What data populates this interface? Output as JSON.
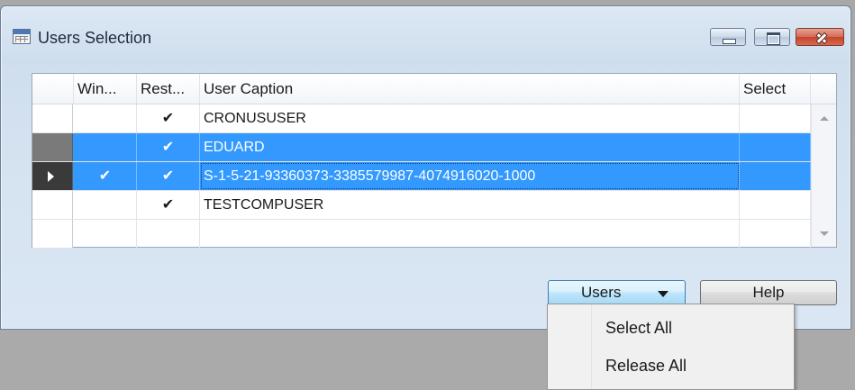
{
  "window": {
    "title": "Users Selection",
    "title_icon": "table-form-icon",
    "controls": {
      "minimize": "minimize-icon",
      "maximize": "maximize-icon",
      "close": "close-icon"
    }
  },
  "grid": {
    "columns": [
      "Win...",
      "Rest...",
      "User Caption",
      "Select"
    ],
    "rows": [
      {
        "win": "",
        "rest": "✔",
        "caption": "CRONUSUSER",
        "select": ""
      },
      {
        "win": "",
        "rest": "✔",
        "caption": "EDUARD",
        "select": ""
      },
      {
        "win": "✔",
        "rest": "✔",
        "caption": "S-1-5-21-93360373-3385579987-4074916020-1000",
        "select": ""
      },
      {
        "win": "",
        "rest": "✔",
        "caption": "TESTCOMPUSER",
        "select": ""
      },
      {
        "win": "",
        "rest": "",
        "caption": "",
        "select": ""
      }
    ],
    "selected_rows": [
      1,
      2
    ],
    "active_row": 2
  },
  "buttons": {
    "users": "Users",
    "help": "Help"
  },
  "users_menu": {
    "items": [
      "Select All",
      "Release All"
    ]
  },
  "colors": {
    "selection": "#3399ff",
    "close_button": "#c4442c"
  }
}
